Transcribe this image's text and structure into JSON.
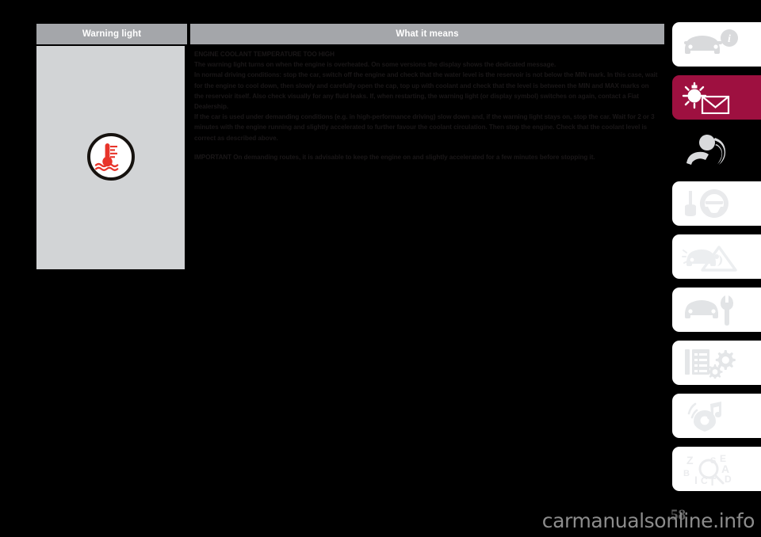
{
  "table": {
    "headers": {
      "left": "Warning light",
      "right": "What it means"
    },
    "symbol": {
      "name": "engine-coolant-temperature-warning-symbol",
      "color": "#e8342a"
    },
    "content": {
      "title": "ENGINE COOLANT TEMPERATURE TOO HIGH",
      "paragraphs": [
        "The warning light turns on when the engine is overheated. On some versions the display shows the dedicated message.",
        "In normal driving conditions: stop the car, switch off the engine and check that the water level is the reservoir is not below the MIN mark. In this case, wait for the engine to cool down, then slowly and carefully open the cap, top up with coolant and check that the level is between the MIN and MAX marks on the reservoir itself. Also check visually for any fluid leaks. If, when restarting, the warning light (or display symbol) switches on again, contact a Fiat Dealership.",
        "If the car is used under demanding conditions (e.g. in high-performance driving) slow down and, if the warning light stays on, stop the car. Wait for 2 or 3 minutes with the engine running and slightly accelerated to further favour the coolant circulation. Then stop the engine. Check that the coolant level is correct as described above."
      ],
      "important": "IMPORTANT On demanding routes, it is advisable to keep the engine on and slightly accelerated for a few minutes before stopping it."
    }
  },
  "tab_rail": {
    "active_color": "#9e1040",
    "items": [
      {
        "icon": "car-info-icon",
        "style": "white",
        "label": "Dashboard and controls"
      },
      {
        "icon": "warning-lamp-message-icon",
        "style": "active",
        "label": "Warning lights and messages"
      },
      {
        "icon": "airbag-safety-icon",
        "style": "dark",
        "label": "Safety"
      },
      {
        "icon": "key-steering-wheel-icon",
        "style": "white",
        "label": "Starting and driving"
      },
      {
        "icon": "car-hazard-triangle-icon",
        "style": "white",
        "label": "In an emergency"
      },
      {
        "icon": "car-wrench-icon",
        "style": "white",
        "label": "Maintenance and care"
      },
      {
        "icon": "list-gears-icon",
        "style": "white",
        "label": "Technical specifications"
      },
      {
        "icon": "multimedia-music-icon",
        "style": "white",
        "label": "Multimedia"
      },
      {
        "icon": "alphabetical-index-icon",
        "style": "white",
        "label": "Alphabetical index"
      }
    ]
  },
  "footer": {
    "page_number": "58",
    "watermark": "carmanualsonline.info"
  }
}
